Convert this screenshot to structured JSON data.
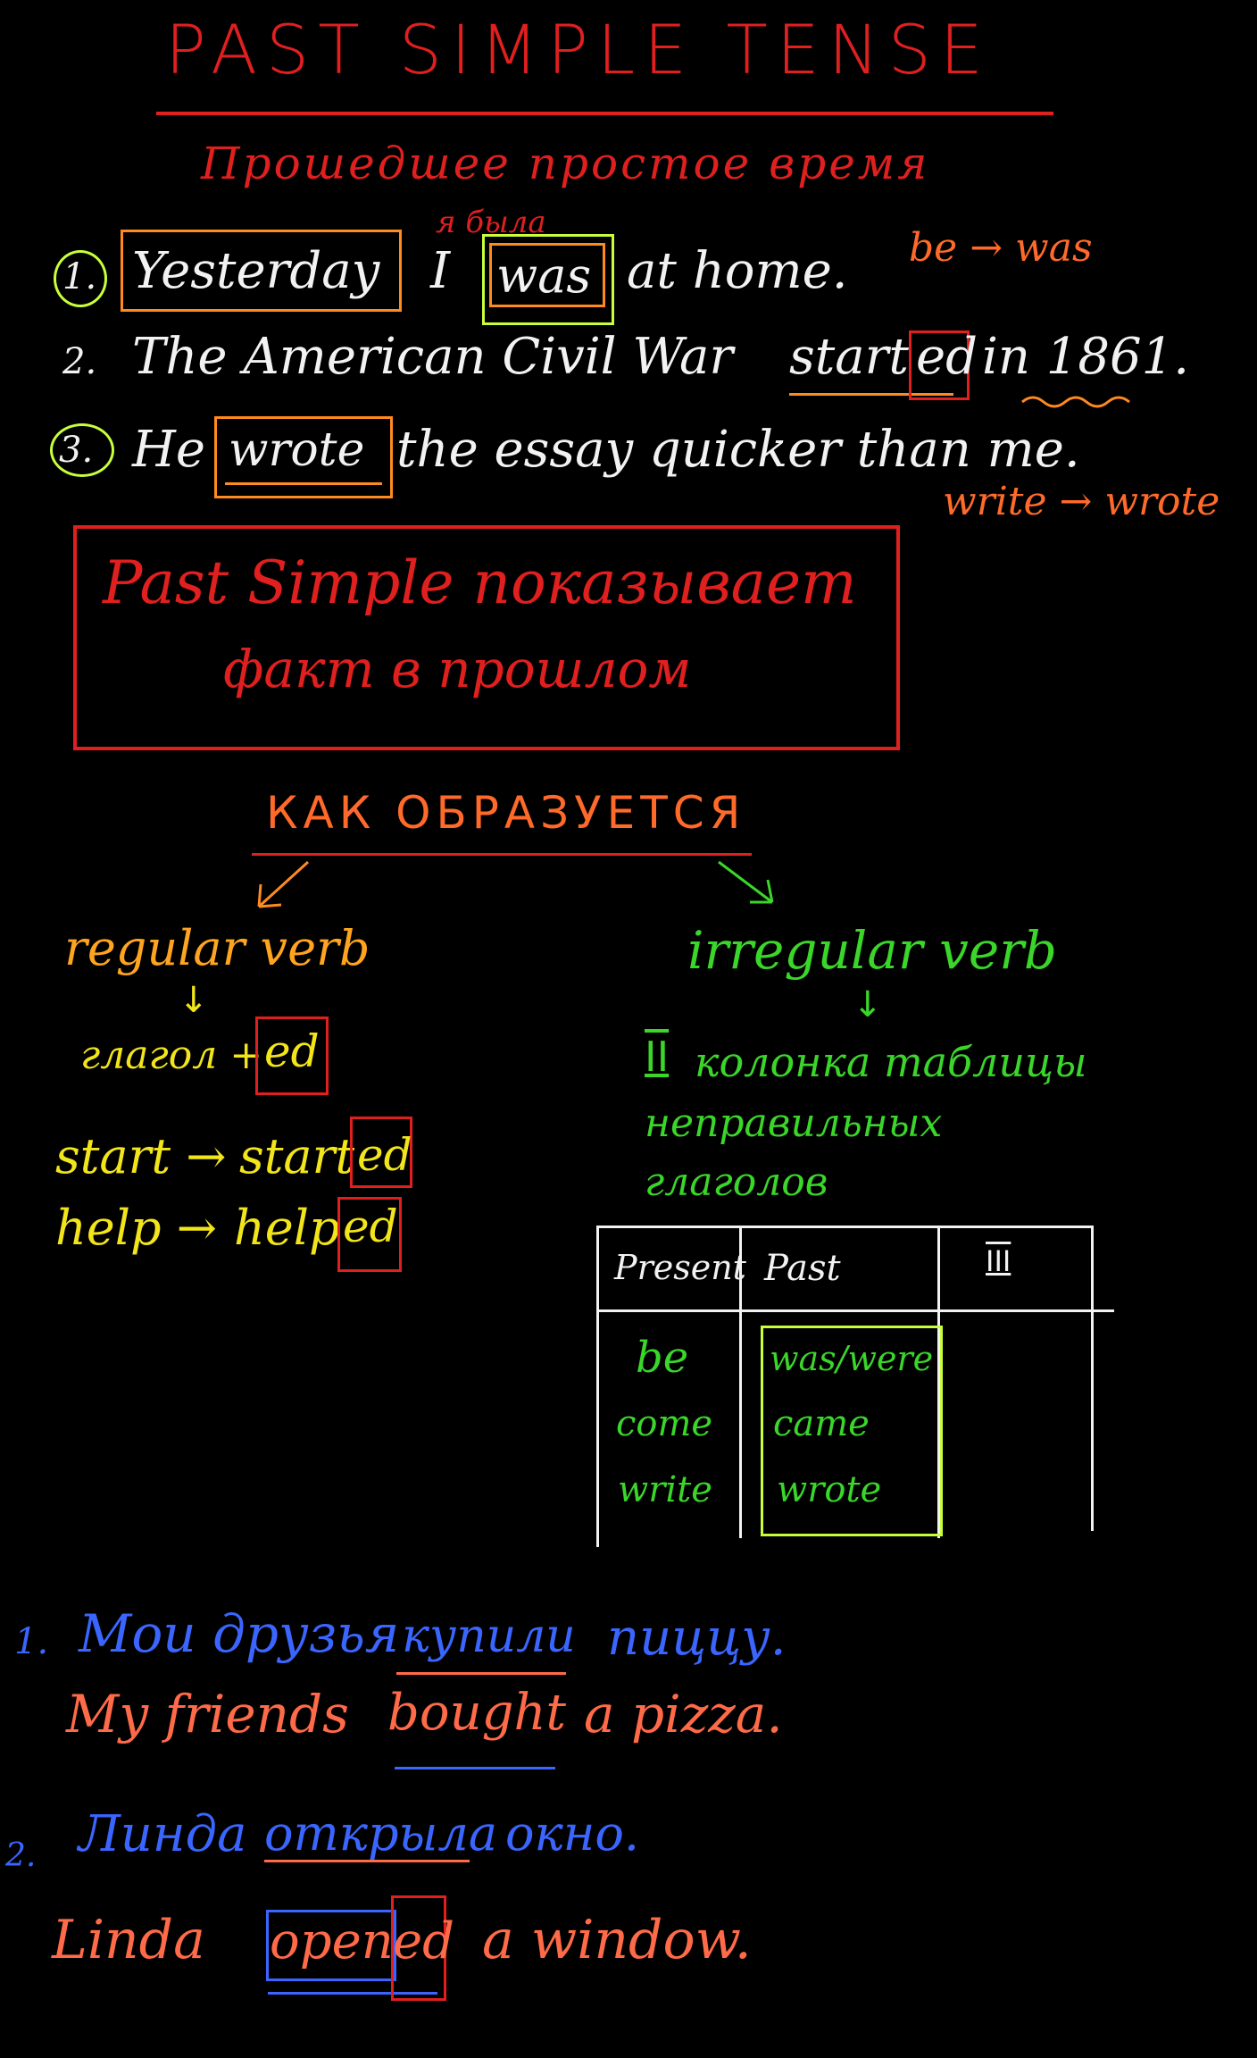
{
  "header": {
    "title": "PAST SIMPLE TENSE",
    "subtitle": "Прошедшее простое время"
  },
  "examples": {
    "annotation_top": "я была",
    "s1": {
      "num": "1.",
      "w1": "Yesterday",
      "w2": "I",
      "w3": "was",
      "w4": "at home."
    },
    "s1_note": "be → was",
    "s2": {
      "num": "2.",
      "text": "The American Civil War",
      "verb": "start",
      "ending": "ed",
      "rest": "in 1861."
    },
    "s3": {
      "num": "3.",
      "w1": "He",
      "w2": "wrote",
      "w3": "the essay quicker than me."
    },
    "s3_note": "write → wrote"
  },
  "rule_box": {
    "line1": "Past Simple показывает",
    "line2": "факт в прошлом"
  },
  "formation": {
    "heading": "КАК ОБРАЗУЕТСЯ",
    "regular": {
      "title": "regular verb",
      "arrow": "↓",
      "formula": "глагол +",
      "formula_ending": "ed",
      "ex1_base": "start →",
      "ex1_stem": "start",
      "ex1_end": "ed",
      "ex2_base": "help →",
      "ex2_stem": "help",
      "ex2_end": "ed"
    },
    "irregular": {
      "title": "irregular verb",
      "arrow": "↓",
      "col": "II",
      "line1": "колонка таблицы",
      "line2": "неправильных",
      "line3": "глаголов"
    }
  },
  "table": {
    "headers": [
      "Present",
      "Past",
      "III"
    ],
    "rows": [
      {
        "present": "be",
        "past": "was/were"
      },
      {
        "present": "come",
        "past": "came"
      },
      {
        "present": "write",
        "past": "wrote"
      }
    ]
  },
  "exercises": {
    "e1": {
      "num": "1.",
      "ru1": "Мои друзья",
      "ru_verb": "купили",
      "ru2": "пиццу.",
      "en1": "My friends",
      "en_verb": "bought",
      "en2": "a pizza."
    },
    "e2": {
      "num": "2.",
      "ru1": "Линда",
      "ru_verb": "открыла",
      "ru2": "окно.",
      "en1": "Linda",
      "en_stem": "open",
      "en_end": "ed",
      "en2": "a window."
    }
  },
  "colors": {
    "title": "#e01f1f",
    "highlight_orange": "#ff8a1f",
    "highlight_green": "#c8ff3a",
    "regular": "#f2e51a",
    "irregular": "#3ad62a",
    "russian": "#3a66ff",
    "english": "#ff6a48"
  }
}
